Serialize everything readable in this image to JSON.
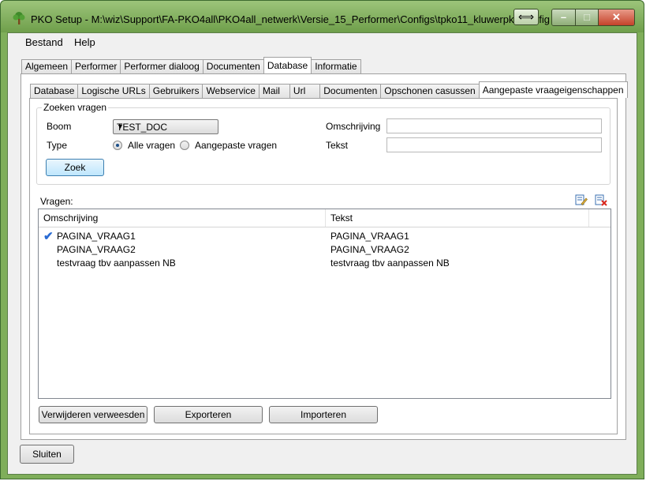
{
  "window": {
    "title": "PKO Setup - M:\\wiz\\Support\\FA-PKO4all\\PKO4all_netwerk\\Versie_15_Performer\\Configs\\tpko11_kluwerpko.config",
    "resize_glyph": "⟺",
    "minimize_glyph": "–",
    "maximize_glyph": "□",
    "close_glyph": "✕"
  },
  "menu": {
    "file": "Bestand",
    "help": "Help"
  },
  "main_tabs": [
    "Algemeen",
    "Performer",
    "Performer dialoog",
    "Documenten",
    "Database",
    "Informatie"
  ],
  "sub_tabs": [
    "Database",
    "Logische URLs",
    "Gebruikers",
    "Webservice",
    "Mail",
    "Url",
    "Documenten",
    "Opschonen casussen",
    "Aangepaste vraageigenschappen"
  ],
  "search": {
    "group_title": "Zoeken vragen",
    "boom_label": "Boom",
    "boom_value": "TEST_DOC",
    "type_label": "Type",
    "radio_all": "Alle vragen",
    "radio_custom": "Aangepaste vragen",
    "omschrijving_label": "Omschrijving",
    "omschrijving_value": "",
    "tekst_label": "Tekst",
    "tekst_value": "",
    "zoek_button": "Zoek"
  },
  "questions": {
    "label": "Vragen:",
    "columns": [
      "Omschrijving",
      "Tekst"
    ],
    "rows": [
      {
        "omschrijving": "PAGINA_VRAAG1",
        "tekst": "PAGINA_VRAAG1",
        "checked": true
      },
      {
        "omschrijving": "PAGINA_VRAAG2",
        "tekst": "PAGINA_VRAAG2",
        "checked": false
      },
      {
        "omschrijving": "testvraag tbv aanpassen NB",
        "tekst": "testvraag tbv aanpassen NB",
        "checked": false
      }
    ],
    "check_glyph": "✔"
  },
  "buttons": {
    "remove_orphans": "Verwijderen verweesden",
    "export": "Exporteren",
    "import": "Importeren",
    "close": "Sluiten"
  },
  "icons": {
    "app": "tree-icon",
    "edit": "edit-icon",
    "delete": "delete-icon"
  },
  "colors": {
    "accent": "#7fae5a",
    "check": "#2a6bd3",
    "delete": "#d9261c"
  }
}
